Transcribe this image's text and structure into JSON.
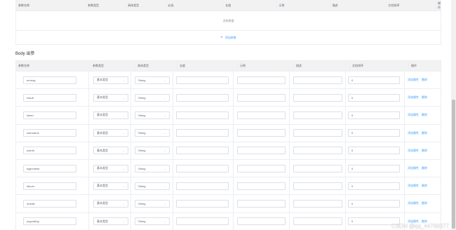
{
  "top_table": {
    "headers": [
      "参数名称",
      "参数类型",
      "具体类型",
      "必选",
      "长度",
      "示例",
      "描述",
      "文档排序",
      "操作"
    ],
    "empty_text": "没有数据"
  },
  "add_param": {
    "icon": "plus-icon",
    "label": "添加参数"
  },
  "section_title": "Body 出参",
  "body_table": {
    "headers": [
      "参数名称",
      "参数类型",
      "具体类型",
      "长度",
      "示例",
      "描述",
      "文档排序",
      "操作"
    ],
    "rows": [
      {
        "name": "errmsg",
        "type": "基本类型",
        "detail": "String",
        "length": "",
        "example": "",
        "desc": "",
        "order": "0"
      },
      {
        "name": "result",
        "type": "基本类型",
        "detail": "String",
        "length": "",
        "example": "",
        "desc": "",
        "order": "0"
      },
      {
        "name": "token",
        "type": "基本类型",
        "detail": "String",
        "length": "",
        "example": "",
        "desc": "",
        "order": "0"
      },
      {
        "name": "username",
        "type": "基本类型",
        "detail": "String",
        "length": "",
        "example": "",
        "desc": "",
        "order": "0"
      },
      {
        "name": "userid",
        "type": "基本类型",
        "detail": "String",
        "length": "",
        "example": "",
        "desc": "",
        "order": "0"
      },
      {
        "name": "loginname",
        "type": "基本类型",
        "detail": "String",
        "length": "",
        "example": "",
        "desc": "",
        "order": "0"
      },
      {
        "name": "idnum",
        "type": "基本类型",
        "detail": "String",
        "length": "",
        "example": "",
        "desc": "",
        "order": "0"
      },
      {
        "name": "mobile",
        "type": "基本类型",
        "detail": "String",
        "length": "",
        "example": "",
        "desc": "",
        "order": "0"
      },
      {
        "name": "orgcoding",
        "type": "基本类型",
        "detail": "String",
        "length": "",
        "example": "",
        "desc": "",
        "order": "0"
      }
    ],
    "action_add_attr": "添加属性",
    "action_delete": "删除"
  },
  "watermark": "CSDN @qq_44766377",
  "colors": {
    "link": "#409eff",
    "header_bg": "#f2f2f2",
    "border": "#ebeef5"
  }
}
